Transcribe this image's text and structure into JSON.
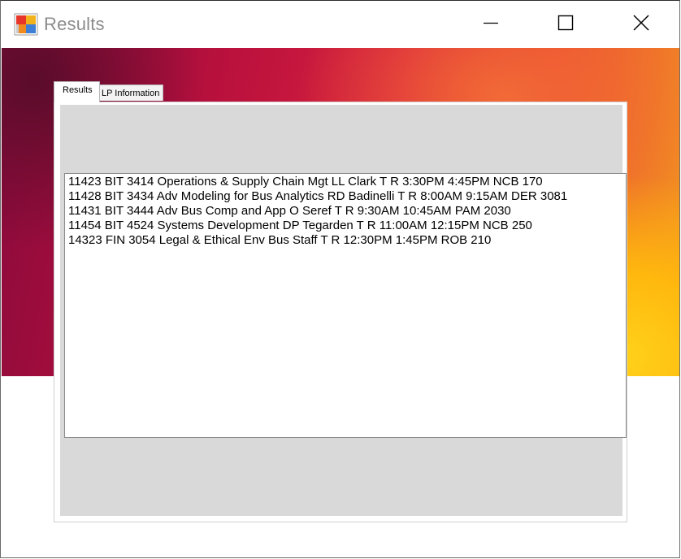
{
  "window": {
    "title": "Results",
    "icon": "app-window-icon",
    "controls": {
      "minimize_icon": "minimize-icon",
      "maximize_icon": "maximize-icon",
      "close_icon": "close-icon"
    }
  },
  "tabs": [
    {
      "label": "Results",
      "active": true
    },
    {
      "label": "LP Information",
      "active": false
    }
  ],
  "results": {
    "items": [
      "11423 BIT 3414 Operations & Supply Chain Mgt LL Clark T R 3:30PM 4:45PM NCB 170",
      "11428 BIT 3434 Adv Modeling for Bus Analytics RD Badinelli T R 8:00AM 9:15AM DER 3081",
      "11431 BIT 3444 Adv Bus Comp and App O Seref T R 9:30AM 10:45AM PAM 2030",
      "11454 BIT 4524 Systems Development DP Tegarden T R 11:00AM 12:15PM NCB 250",
      "14323 FIN 3054 Legal & Ethical Env Bus Staff T R 12:30PM 1:45PM ROB 210"
    ]
  },
  "colors": {
    "panel_background": "#d9d9d9",
    "title_text": "#8c8c8c"
  }
}
